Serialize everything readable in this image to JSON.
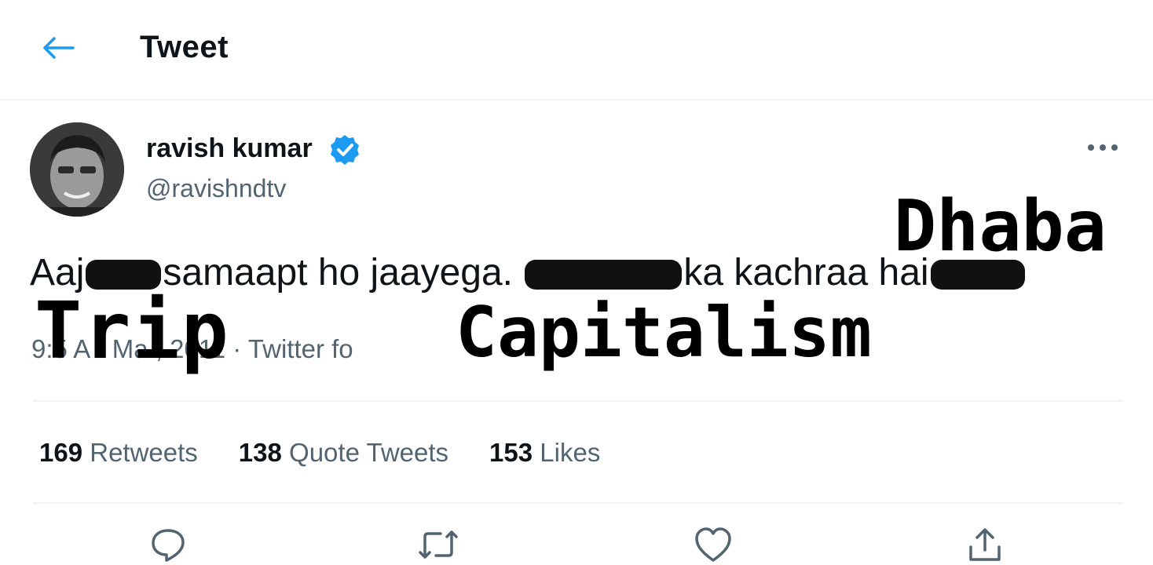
{
  "header": {
    "back_icon": "arrow-left-icon",
    "title": "Tweet"
  },
  "author": {
    "name": "ravish kumar",
    "handle": "@ravishndtv",
    "verified_icon": "verified-badge-icon",
    "verified_color": "#1d9bf0"
  },
  "tweet": {
    "text_part1": "Aaj",
    "text_part2": "samaapt ho jaayega.",
    "text_part3": "ka kachraa hai",
    "meta": "9:5  A  · Ma   , 2011 · Twitter fo"
  },
  "overlays": {
    "trip": "Trip",
    "capitalism": "Capitalism",
    "dhaba": "Dhaba"
  },
  "stats": [
    {
      "count": "169",
      "label": "Retweets"
    },
    {
      "count": "138",
      "label": "Quote Tweets"
    },
    {
      "count": "153",
      "label": "Likes"
    }
  ],
  "actions": [
    "reply-icon",
    "retweet-icon",
    "like-icon",
    "share-icon"
  ],
  "colors": {
    "accent": "#1d9bf0",
    "text": "#0f1419",
    "secondary": "#536471"
  }
}
